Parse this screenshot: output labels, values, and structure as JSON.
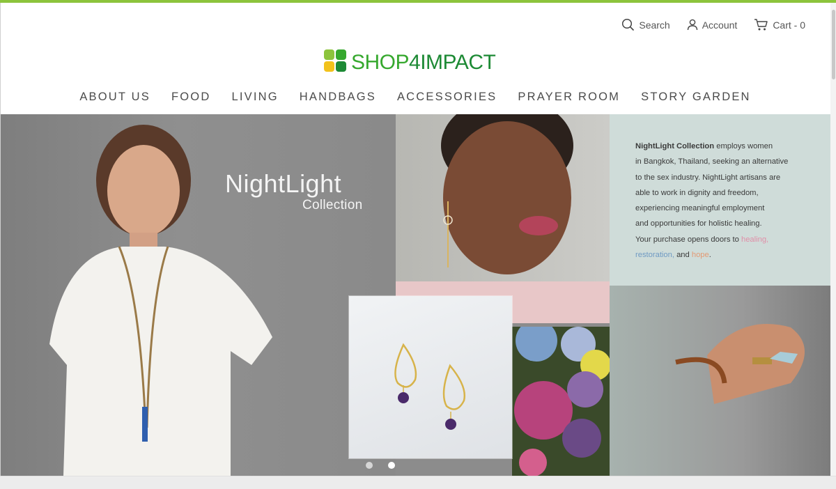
{
  "colors": {
    "top_bar": "#8cc43c",
    "logo_green": "#36a82e",
    "logo_dark": "#1d8a35",
    "accent_lime": "#8cc43c"
  },
  "util": {
    "search_label": "Search",
    "account_label": "Account",
    "cart_label": "Cart - 0"
  },
  "logo": {
    "shop": "SHOP",
    "four": "4",
    "impact": "IMPACT"
  },
  "nav": {
    "items": [
      "ABOUT US",
      "FOOD",
      "LIVING",
      "HANDBAGS",
      "ACCESSORIES",
      "PRAYER ROOM",
      "STORY GARDEN"
    ]
  },
  "hero": {
    "title": "NightLight",
    "subtitle": "Collection",
    "desc_brand": "NightLight Collection",
    "desc_l1_rest": " employs women",
    "desc_l2": "in Bangkok, Thailand, seeking an alternative",
    "desc_l3": "to the sex industry. NightLight artisans are",
    "desc_l4": "able to work in dignity and freedom,",
    "desc_l5": "experiencing meaningful employment",
    "desc_l6": "and opportunities for holistic healing.",
    "desc_l7": "Your purchase opens doors to ",
    "kw_healing": "healing,",
    "kw_restoration": "restoration,",
    "kw_and": " and ",
    "kw_hope": "hope",
    "kw_end": "."
  },
  "slider": {
    "count": 2,
    "active": 2
  }
}
